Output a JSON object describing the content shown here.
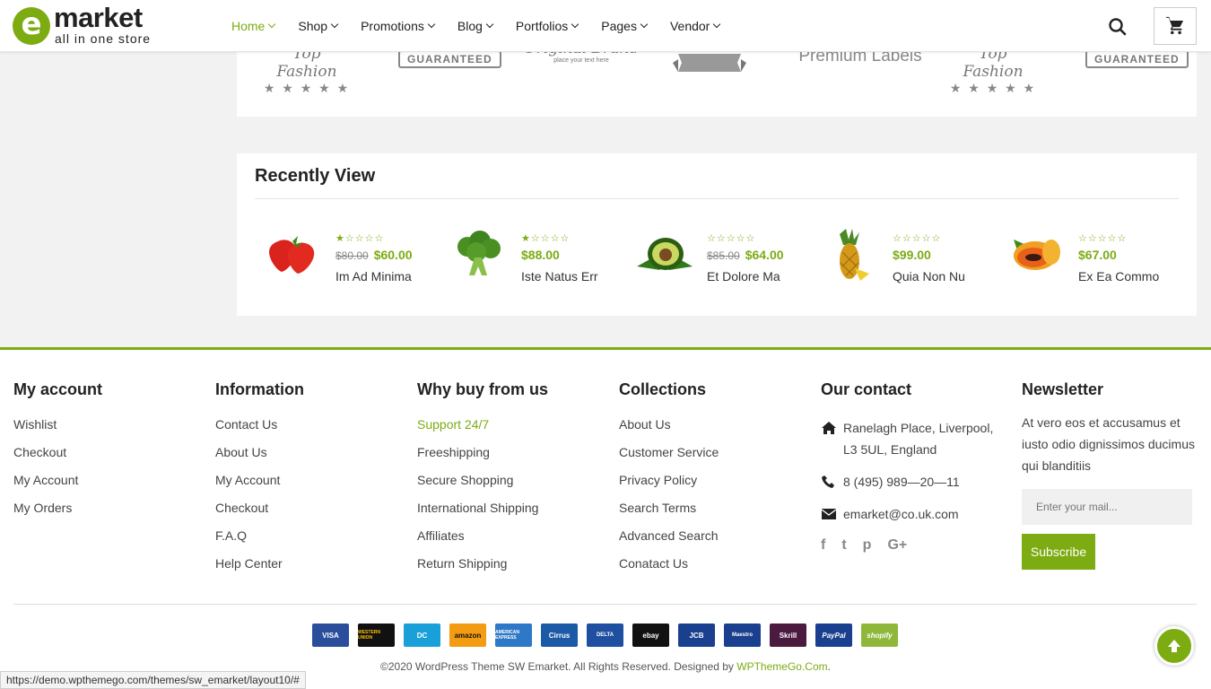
{
  "logo": {
    "letter": "e",
    "word": "market",
    "tagline": "all in one store"
  },
  "nav": [
    {
      "label": "Home",
      "active": true
    },
    {
      "label": "Shop"
    },
    {
      "label": "Promotions"
    },
    {
      "label": "Blog"
    },
    {
      "label": "Portfolios"
    },
    {
      "label": "Pages"
    },
    {
      "label": "Vendor"
    }
  ],
  "brands": [
    {
      "text": "Top Fashion",
      "stars": "★ ★ ★ ★ ★"
    },
    {
      "text": "GUARANTEED"
    },
    {
      "text": "Original Brand",
      "sub": "place your text here"
    },
    {
      "text": ""
    },
    {
      "text": "Premium Labels"
    },
    {
      "text": "Top Fashion",
      "stars": "★ ★ ★ ★ ★"
    },
    {
      "text": "GUARANTEED"
    }
  ],
  "recent": {
    "title": "Recently View",
    "items": [
      {
        "name": "Im Ad Minima",
        "old_price": "$80.00",
        "price": "$60.00",
        "stars": "★☆☆☆☆",
        "icon": "strawberry-icon"
      },
      {
        "name": "Iste Natus Err",
        "old_price": "",
        "price": "$88.00",
        "stars": "★☆☆☆☆",
        "icon": "broccoli-icon"
      },
      {
        "name": "Et Dolore Ma",
        "old_price": "$85.00",
        "price": "$64.00",
        "stars": "☆☆☆☆☆",
        "icon": "avocado-icon"
      },
      {
        "name": "Quia Non Nu",
        "old_price": "",
        "price": "$99.00",
        "stars": "☆☆☆☆☆",
        "icon": "pineapple-icon"
      },
      {
        "name": "Ex Ea Commo",
        "old_price": "",
        "price": "$67.00",
        "stars": "☆☆☆☆☆",
        "icon": "papaya-icon"
      }
    ]
  },
  "footer": {
    "my_account": {
      "title": "My account",
      "links": [
        "Wishlist",
        "Checkout",
        "My Account",
        "My Orders"
      ]
    },
    "information": {
      "title": "Information",
      "links": [
        "Contact Us",
        "About Us",
        "My Account",
        "Checkout",
        "F.A.Q",
        "Help Center"
      ]
    },
    "why_buy": {
      "title": "Why buy from us",
      "links": [
        "Support 24/7",
        "Freeshipping",
        "Secure Shopping",
        "International Shipping",
        "Affiliates",
        "Return Shipping"
      ]
    },
    "collections": {
      "title": "Collections",
      "links": [
        "About Us",
        "Customer Service",
        "Privacy Policy",
        "Search Terms",
        "Advanced Search",
        "Conatact Us"
      ]
    },
    "contact": {
      "title": "Our contact",
      "address": "Ranelagh Place, Liverpool, L3 5UL, England",
      "phone": "8 (495) 989—20—11",
      "email": "emarket@co.uk.com",
      "social": [
        "f",
        "t",
        "p",
        "G+"
      ]
    },
    "newsletter": {
      "title": "Newsletter",
      "text": "At vero eos et accusamus et iusto odio dignissimos ducimus qui blanditiis",
      "placeholder": "Enter your mail...",
      "button": "Subscribe"
    },
    "payments": [
      {
        "label": "VISA",
        "color": "#2a4e9c"
      },
      {
        "label": "WESTERN UNION",
        "color": "#111111"
      },
      {
        "label": "DC",
        "color": "#1aa0d8"
      },
      {
        "label": "amazon",
        "color": "#f39c12"
      },
      {
        "label": "AMERICAN EXPRESS",
        "color": "#2e78c8"
      },
      {
        "label": "Cirrus",
        "color": "#1b5aa6"
      },
      {
        "label": "DELTA",
        "color": "#1e4fa0"
      },
      {
        "label": "ebay",
        "color": "#111111"
      },
      {
        "label": "JCB",
        "color": "#1a3f8f"
      },
      {
        "label": "Maestro",
        "color": "#1a3f8f"
      },
      {
        "label": "Skrill",
        "color": "#4a1a3f"
      },
      {
        "label": "PayPal",
        "color": "#1a3f8f"
      },
      {
        "label": "shopify",
        "color": "#8fb83a"
      }
    ],
    "copyright": "©2020 WordPress Theme SW Emarket. All Rights Reserved. Designed by ",
    "copyright_link": "WPThemeGo.Com",
    "copyright_end": "."
  },
  "status_url": "https://demo.wpthemego.com/themes/sw_emarket/layout10/#",
  "colors": {
    "accent": "#7cac12"
  }
}
